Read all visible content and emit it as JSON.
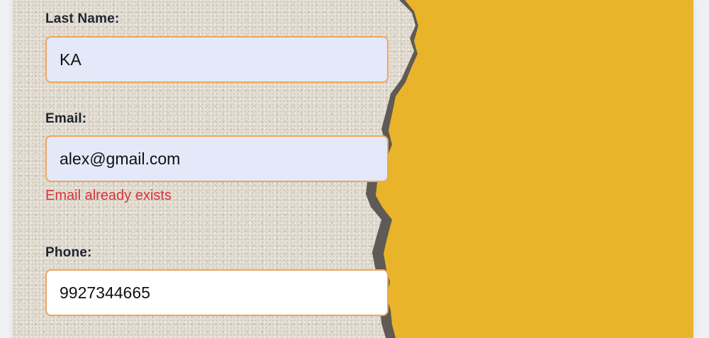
{
  "form": {
    "last_name": {
      "label": "Last Name:",
      "value": "KA"
    },
    "email": {
      "label": "Email:",
      "value": "alex@gmail.com",
      "error": "Email already exists"
    },
    "phone": {
      "label": "Phone:",
      "value": "9927344665"
    }
  },
  "colors": {
    "input_border": "#eea55e",
    "autofill_background": "#e3e9f8",
    "error_text": "#d8333a",
    "panel_yellow": "#f0b325",
    "paper_background": "#e3ddd2",
    "torn_edge": "#5f5a55"
  }
}
